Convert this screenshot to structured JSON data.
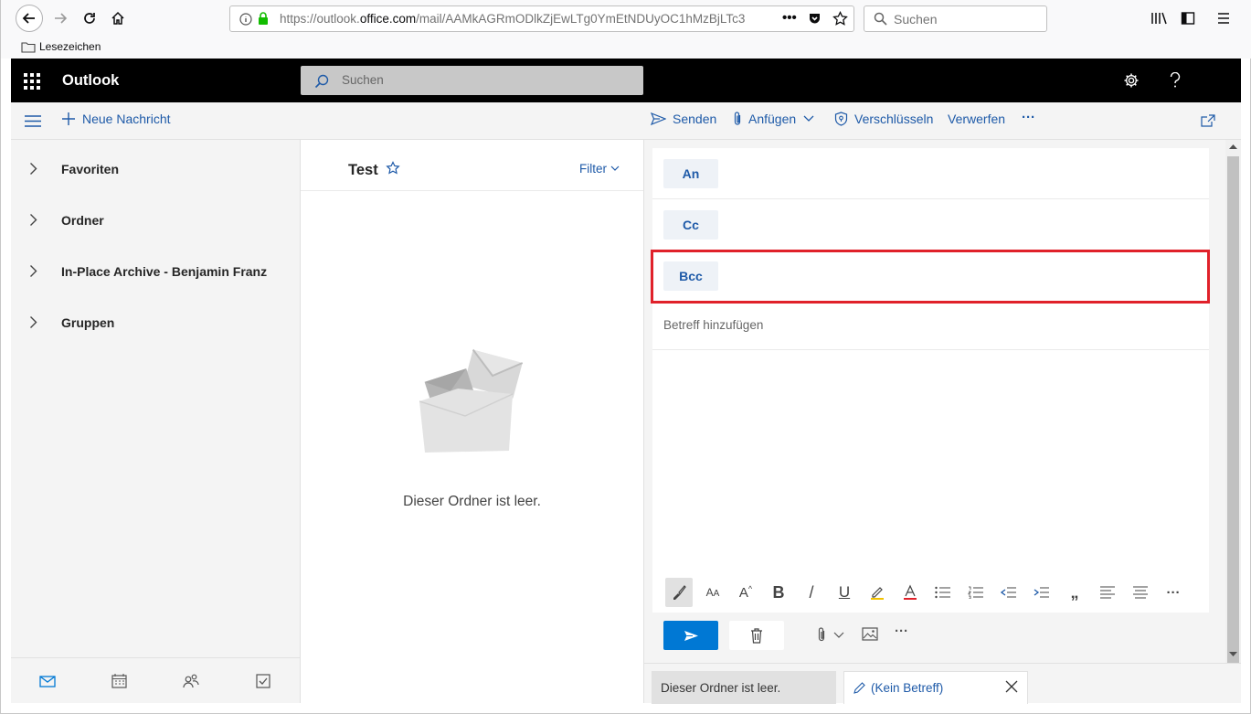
{
  "browser": {
    "url_prefix": "https://outlook.",
    "url_domain": "office.com",
    "url_path": "/mail/AAMkAGRmODlkZjEwLTg0YmEtNDUyOC1hMzBjLTc3",
    "search_placeholder": "Suchen",
    "bookmarks_label": "Lesezeichen"
  },
  "outlook": {
    "app_title": "Outlook",
    "search_placeholder": "Suchen"
  },
  "commandbar": {
    "new_message": "Neue Nachricht",
    "send": "Senden",
    "attach": "Anfügen",
    "encrypt": "Verschlüsseln",
    "discard": "Verwerfen",
    "more": "···"
  },
  "sidebar": {
    "items": [
      {
        "label": "Favoriten"
      },
      {
        "label": "Ordner"
      },
      {
        "label": "In-Place Archive - Benjamin Franz"
      },
      {
        "label": "Gruppen"
      }
    ]
  },
  "message_list": {
    "folder_title": "Test",
    "filter_label": "Filter",
    "empty_text": "Dieser Ordner ist leer."
  },
  "compose": {
    "to_label": "An",
    "cc_label": "Cc",
    "bcc_label": "Bcc",
    "subject_placeholder": "Betreff hinzufügen",
    "format_quote": "„",
    "format_more": "···",
    "sendbar_more": "···"
  },
  "tabs": {
    "folder_tab": "Dieser Ordner ist leer.",
    "draft_tab": "(Kein Betreff)"
  },
  "colors": {
    "accent": "#0078d4",
    "link": "#1e5aa8",
    "highlight": "#e0212a"
  }
}
